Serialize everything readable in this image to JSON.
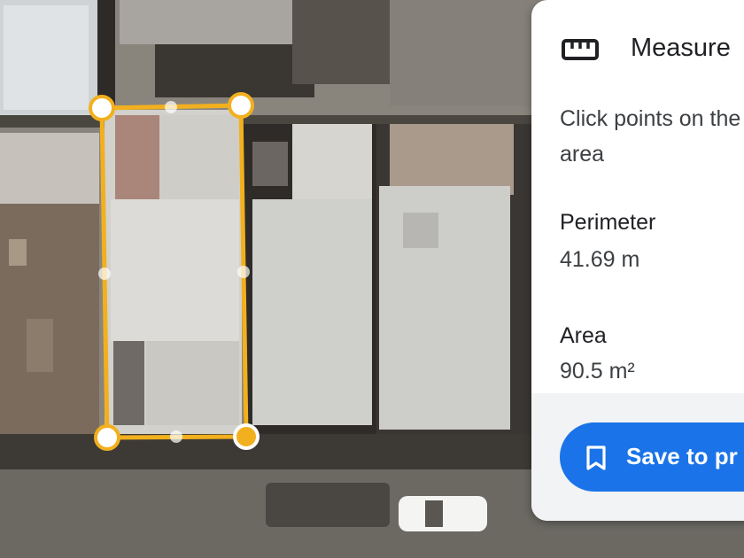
{
  "map": {
    "measure_polygon": {
      "line_color": "#f2b01e",
      "vertex_fill": "#ffffff",
      "active_vertex_fill": "#f2b01e"
    }
  },
  "panel": {
    "title": "Measure",
    "title_icon": "ruler-icon",
    "instructions": "Click points on the area",
    "perimeter": {
      "label": "Perimeter",
      "value": "41.69 m"
    },
    "area": {
      "label": "Area",
      "value": "90.5 m²"
    },
    "save_button": {
      "label": "Save to pr",
      "icon": "bookmark-icon",
      "color": "#1a73e8"
    }
  }
}
